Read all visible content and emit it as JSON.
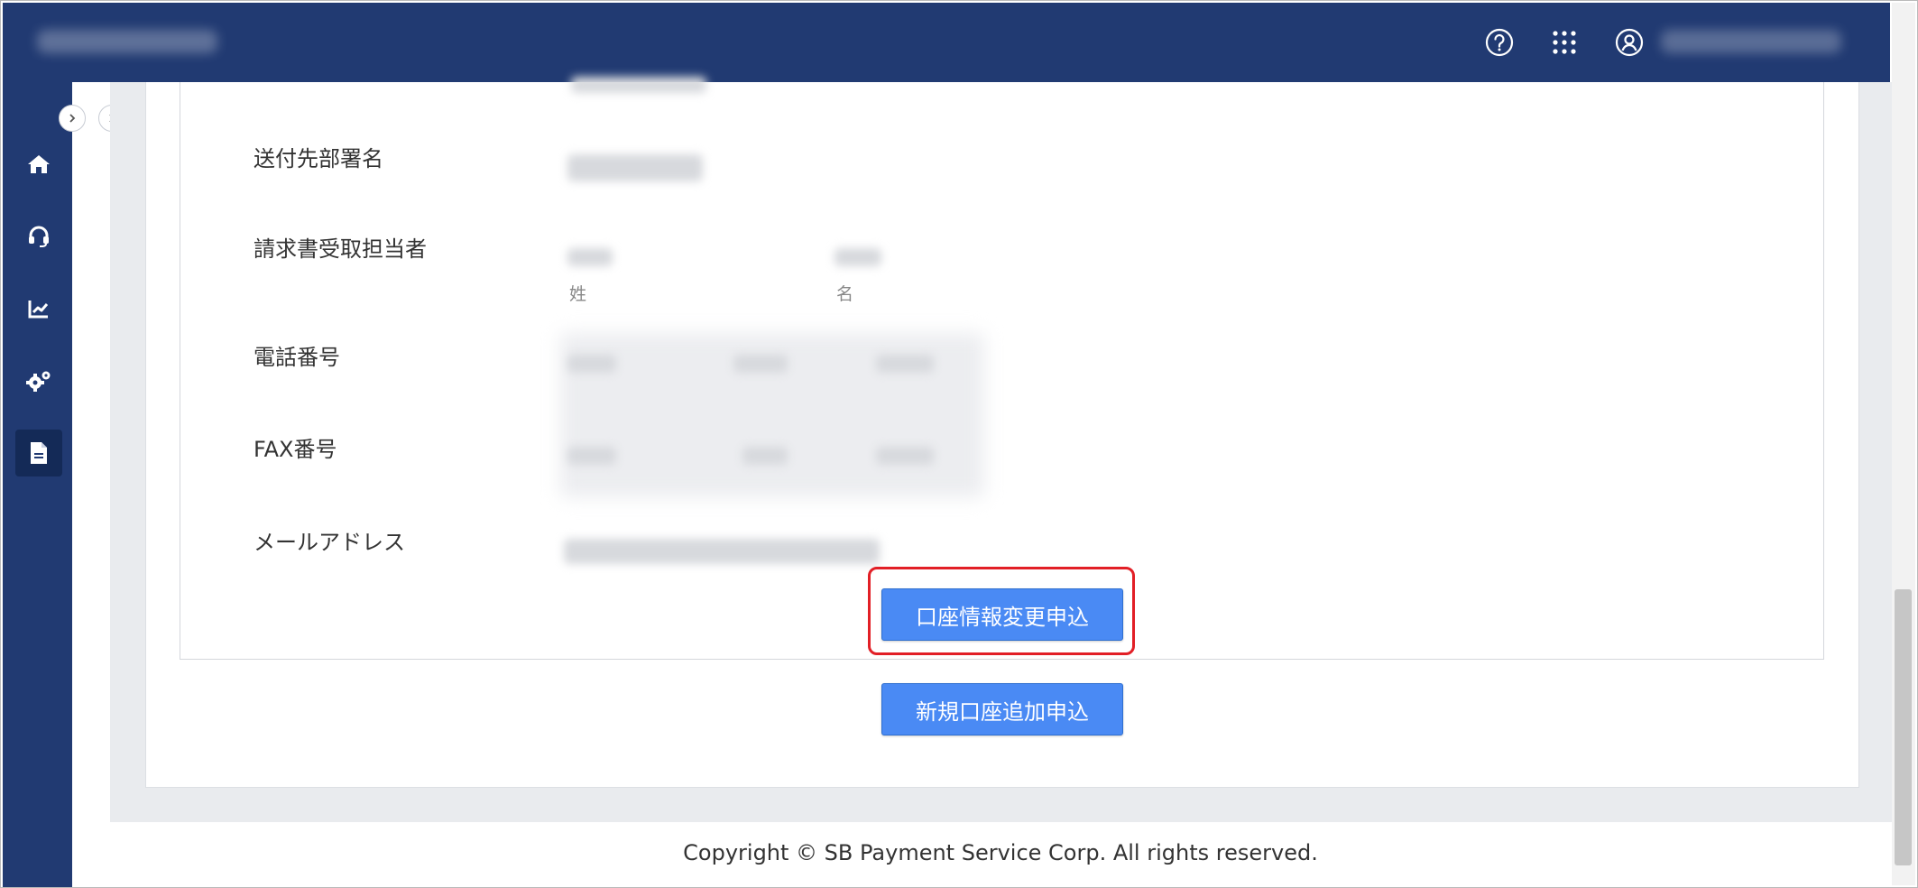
{
  "header": {
    "icons": [
      "help-icon",
      "apps-grid-icon",
      "user-icon"
    ]
  },
  "sidebar": {
    "items": [
      {
        "icon": "home-icon"
      },
      {
        "icon": "support-headset-icon"
      },
      {
        "icon": "chart-icon"
      },
      {
        "icon": "settings-gears-icon"
      },
      {
        "icon": "document-icon",
        "active": true
      }
    ]
  },
  "form": {
    "department_label": "送付先部署名",
    "invoice_contact_label": "請求書受取担当者",
    "last_name_caption": "姓",
    "first_name_caption": "名",
    "phone_label": "電話番号",
    "fax_label": "FAX番号",
    "email_label": "メールアドレス"
  },
  "buttons": {
    "change_account": "口座情報変更申込",
    "add_account": "新規口座追加申込"
  },
  "footer": {
    "copyright": "Copyright © SB Payment Service Corp. All rights reserved."
  },
  "colors": {
    "navy": "#213a72",
    "button_blue": "#4a8af4",
    "highlight_red": "#e21f26"
  }
}
